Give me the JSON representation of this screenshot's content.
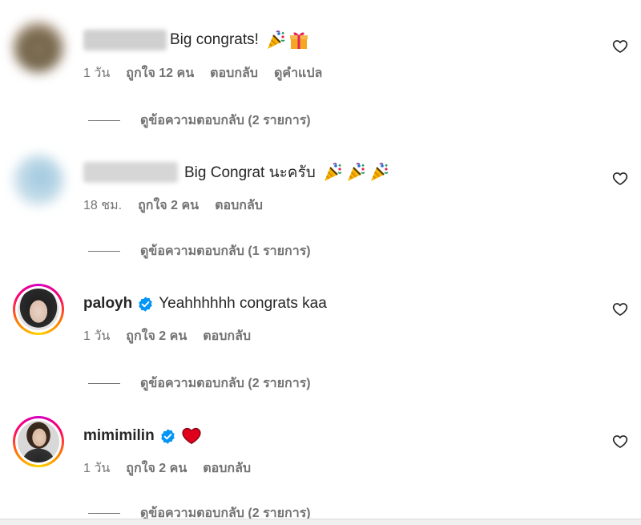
{
  "comments": [
    {
      "username": "",
      "username_hidden": true,
      "verified": false,
      "text": "Big congrats!",
      "emoji": [
        "party-popper",
        "gift"
      ],
      "time": "1 วัน",
      "likes": "ถูกใจ 12 คน",
      "reply_label": "ตอบกลับ",
      "translate_label": "ดูคำแปล",
      "view_replies": "ดูข้อความตอบกลับ (2 รายการ)"
    },
    {
      "username": "",
      "username_hidden": true,
      "verified": false,
      "text": "Big Congrat นะครับ",
      "emoji": [
        "party-popper",
        "party-popper",
        "party-popper"
      ],
      "time": "18 ชม.",
      "likes": "ถูกใจ 2 คน",
      "reply_label": "ตอบกลับ",
      "view_replies": "ดูข้อความตอบกลับ (1 รายการ)"
    },
    {
      "username": "paloyh",
      "verified": true,
      "text": "Yeahhhhhh congrats kaa",
      "emoji": [],
      "time": "1 วัน",
      "likes": "ถูกใจ 2 คน",
      "reply_label": "ตอบกลับ",
      "view_replies": "ดูข้อความตอบกลับ (2 รายการ)"
    },
    {
      "username": "mimimilin",
      "verified": true,
      "text": "",
      "emoji": [
        "red-heart"
      ],
      "time": "1 วัน",
      "likes": "ถูกใจ 2 คน",
      "reply_label": "ตอบกลับ",
      "view_replies": "ดูข้อความตอบกลับ (2 รายการ)"
    }
  ],
  "icons": {
    "like": "heart-outline-icon",
    "verified": "verified-badge-icon"
  },
  "colors": {
    "verified": "#0095f6",
    "secondary_text": "#737373",
    "primary_text": "#262626",
    "story_ring": [
      "#d300c5",
      "#ff0069",
      "#ff7a00",
      "#ffd600"
    ]
  }
}
